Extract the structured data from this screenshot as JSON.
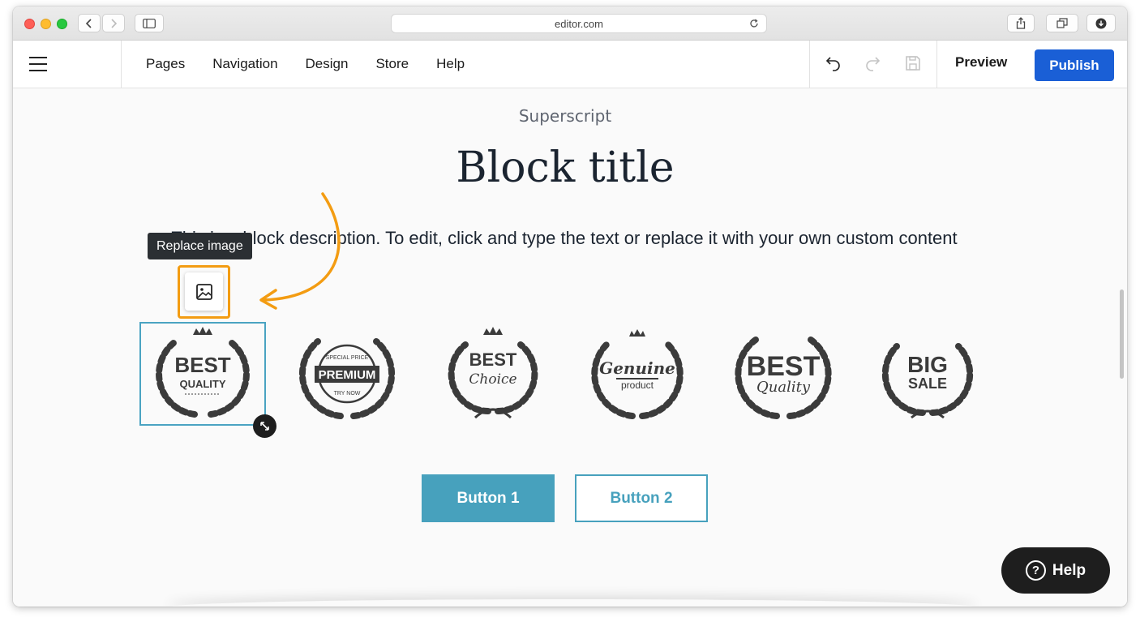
{
  "browser": {
    "url": "editor.com"
  },
  "toolbar": {
    "menu": [
      "Pages",
      "Navigation",
      "Design",
      "Store",
      "Help"
    ],
    "preview_label": "Preview",
    "publish_label": "Publish"
  },
  "block": {
    "superscript": "Superscript",
    "title": "Block title",
    "description": "This is a block description. To edit, click and type the text or replace it with your own custom content"
  },
  "tooltip": "Replace image",
  "badges": [
    {
      "line1": "BEST",
      "line2": "QUALITY"
    },
    {
      "line1": "PREMIUM",
      "line2": "SPECIAL PRICE",
      "line3": "TRY NOW"
    },
    {
      "line1": "BEST",
      "line2": "Choice"
    },
    {
      "line1": "Genuine",
      "line2": "product"
    },
    {
      "line1": "BEST",
      "line2": "Quality"
    },
    {
      "line1": "BIG",
      "line2": "SALE"
    }
  ],
  "buttons": {
    "button1": "Button 1",
    "button2": "Button 2"
  },
  "help": {
    "label": "Help"
  },
  "colors": {
    "accent": "#47a1bd",
    "publish": "#1a5fd6",
    "highlight": "#f39c12",
    "badge": "#3b3b3b"
  }
}
